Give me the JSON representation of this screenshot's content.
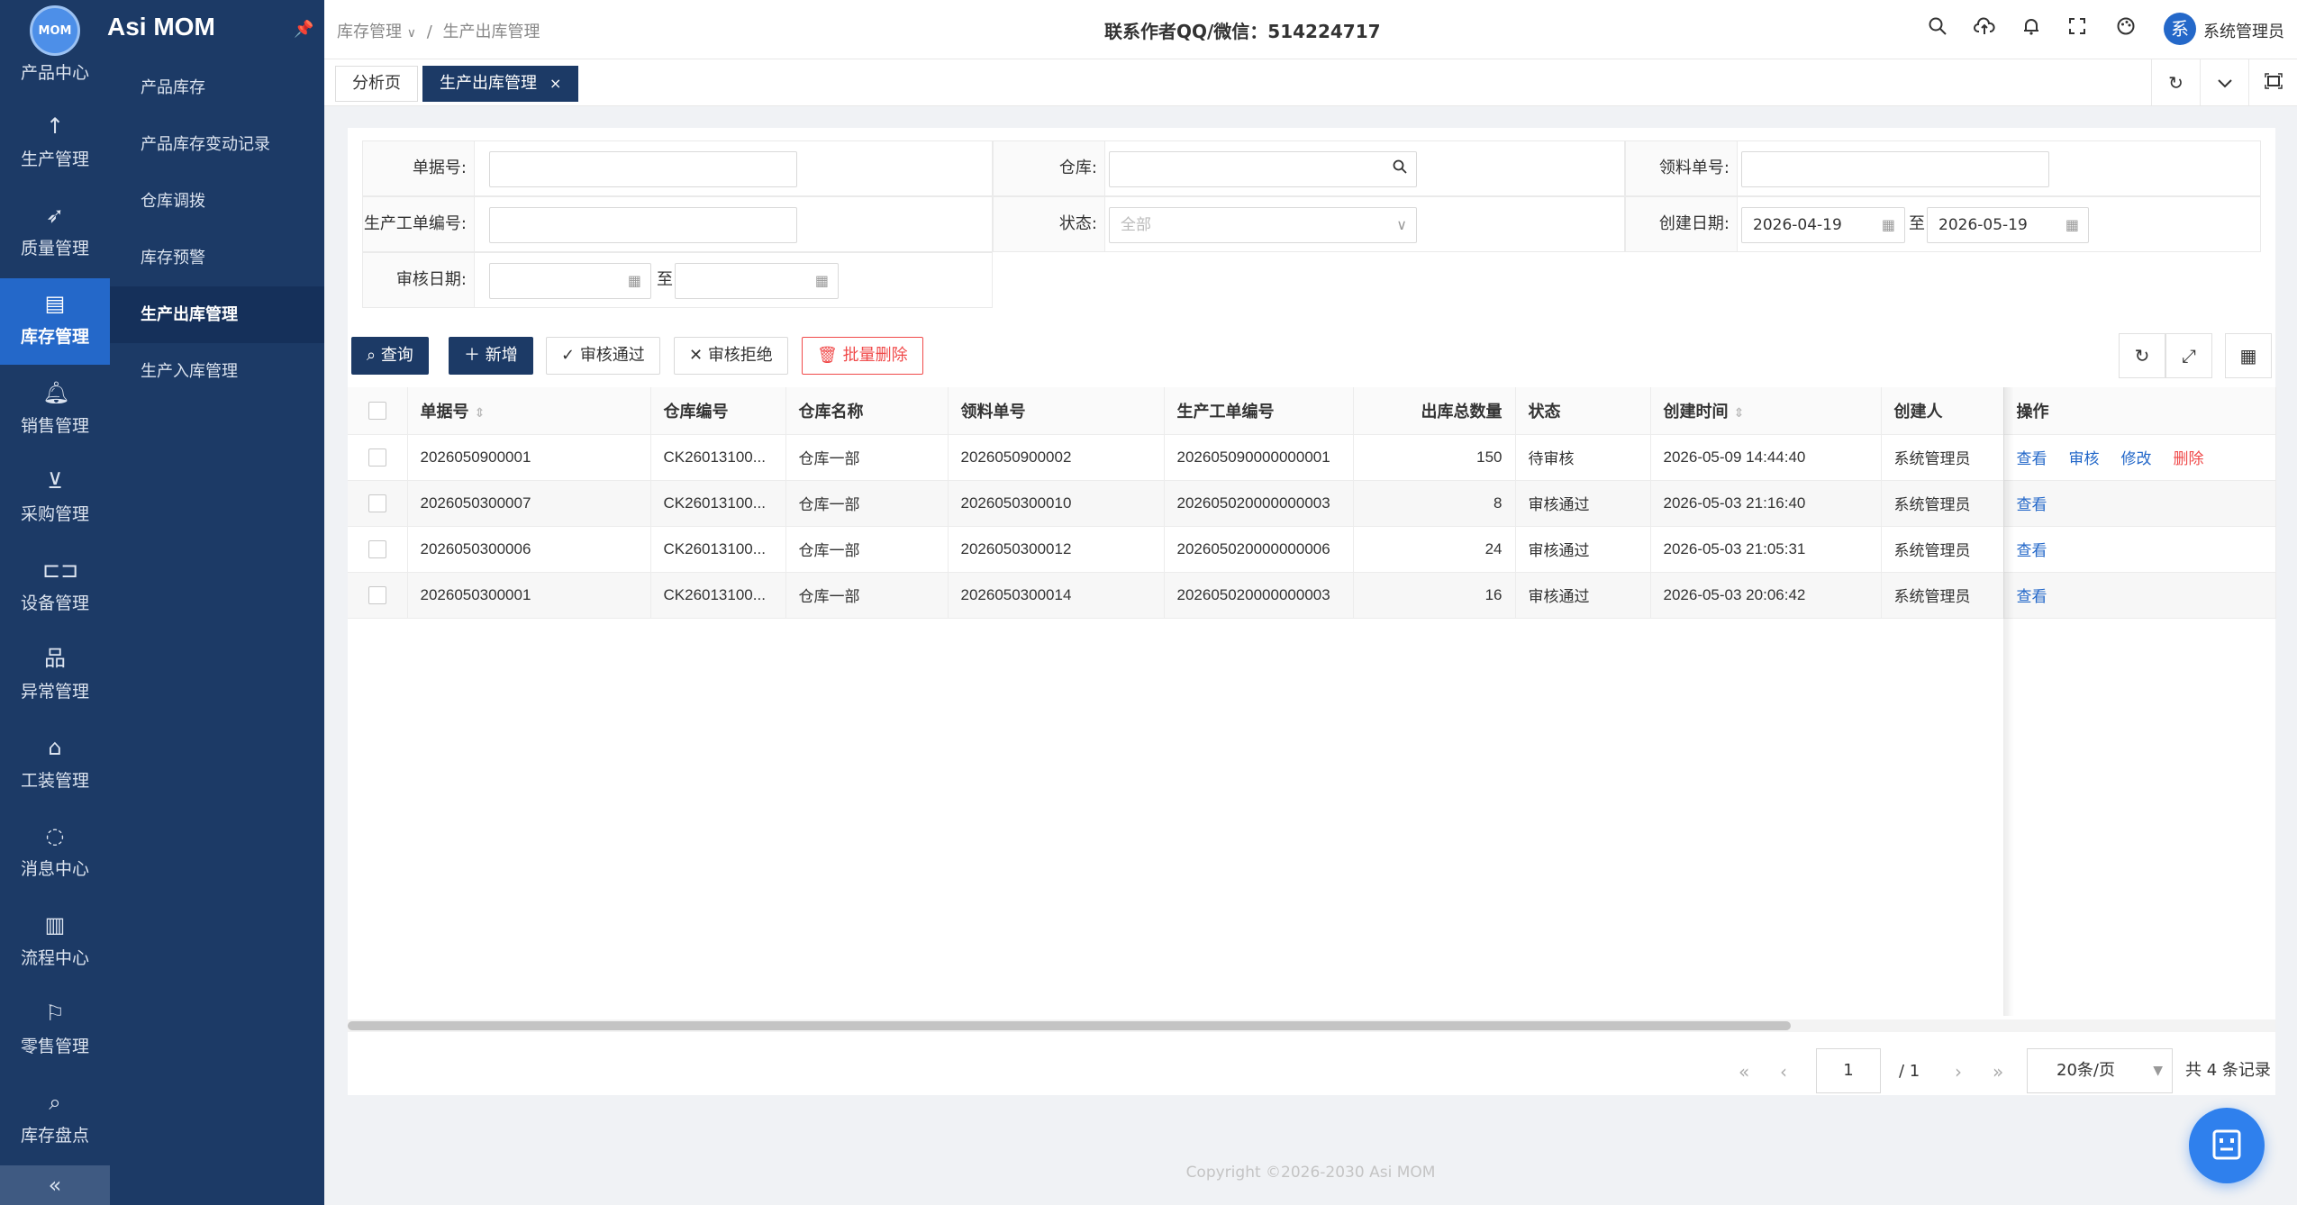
{
  "app": {
    "name": "Asi MOM",
    "logo_text": "MOM"
  },
  "rail": [
    {
      "label": "产品中心",
      "icon": "product-icon"
    },
    {
      "label": "生产管理",
      "icon": "arrow-up-icon"
    },
    {
      "label": "质量管理",
      "icon": "rocket-icon"
    },
    {
      "label": "库存管理",
      "icon": "inventory-icon",
      "active": true
    },
    {
      "label": "销售管理",
      "icon": "bell-icon"
    },
    {
      "label": "采购管理",
      "icon": "purchase-icon"
    },
    {
      "label": "设备管理",
      "icon": "device-icon"
    },
    {
      "label": "异常管理",
      "icon": "org-chart-icon"
    },
    {
      "label": "工装管理",
      "icon": "bank-icon"
    },
    {
      "label": "消息中心",
      "icon": "message-icon"
    },
    {
      "label": "流程中心",
      "icon": "flow-icon"
    },
    {
      "label": "零售管理",
      "icon": "flag-icon"
    },
    {
      "label": "库存盘点",
      "icon": "search-doc-icon"
    }
  ],
  "collapse_glyph": "«",
  "submenu": [
    {
      "label": "产品库存"
    },
    {
      "label": "产品库存变动记录"
    },
    {
      "label": "仓库调拨"
    },
    {
      "label": "库存预警"
    },
    {
      "label": "生产出库管理",
      "active": true
    },
    {
      "label": "生产入库管理"
    }
  ],
  "header": {
    "breadcrumb": [
      "库存管理",
      "生产出库管理"
    ],
    "contact": "联系作者QQ/微信：514224717",
    "user_avatar": "系",
    "user_name": "系统管理员"
  },
  "tabs": [
    {
      "label": "分析页"
    },
    {
      "label": "生产出库管理",
      "active": true,
      "close": "×"
    }
  ],
  "form": {
    "doc_no_label": "单据号:",
    "warehouse_label": "仓库:",
    "pick_no_label": "领料单号:",
    "work_order_label": "生产工单编号:",
    "status_label": "状态:",
    "status_placeholder": "全部",
    "created_label": "创建日期:",
    "created_from": "2026-04-19",
    "created_to": "2026-05-19",
    "audit_label": "审核日期:",
    "to_label": "至"
  },
  "toolbar": {
    "query": "查询",
    "add": "新增",
    "approve": "审核通过",
    "reject": "审核拒绝",
    "batch_delete": "批量删除"
  },
  "table": {
    "columns": [
      "单据号",
      "仓库编号",
      "仓库名称",
      "领料单号",
      "生产工单编号",
      "出库总数量",
      "状态",
      "创建时间",
      "创建人",
      "操作"
    ],
    "rows": [
      {
        "doc_no": "2026050900001",
        "wh_code": "CK26013100...",
        "wh_name": "仓库一部",
        "pick_no": "2026050900002",
        "wo_no": "202605090000000001",
        "qty": "150",
        "status": "待审核",
        "created": "2026-05-09 14:44:40",
        "creator": "系统管理员",
        "ops": [
          "查看",
          "审核",
          "修改",
          "删除"
        ]
      },
      {
        "doc_no": "2026050300007",
        "wh_code": "CK26013100...",
        "wh_name": "仓库一部",
        "pick_no": "2026050300010",
        "wo_no": "202605020000000003",
        "qty": "8",
        "status": "审核通过",
        "created": "2026-05-03 21:16:40",
        "creator": "系统管理员",
        "ops": [
          "查看"
        ]
      },
      {
        "doc_no": "2026050300006",
        "wh_code": "CK26013100...",
        "wh_name": "仓库一部",
        "pick_no": "2026050300012",
        "wo_no": "202605020000000006",
        "qty": "24",
        "status": "审核通过",
        "created": "2026-05-03 21:05:31",
        "creator": "系统管理员",
        "ops": [
          "查看"
        ]
      },
      {
        "doc_no": "2026050300001",
        "wh_code": "CK26013100...",
        "wh_name": "仓库一部",
        "pick_no": "2026050300014",
        "wo_no": "202605020000000003",
        "qty": "16",
        "status": "审核通过",
        "created": "2026-05-03 20:06:42",
        "creator": "系统管理员",
        "ops": [
          "查看"
        ]
      }
    ]
  },
  "pager": {
    "page": "1",
    "total_pages": "/ 1",
    "page_size": "20条/页",
    "total": "共 4 条记录"
  },
  "footer": "Copyright ©2026-2030 Asi MOM"
}
